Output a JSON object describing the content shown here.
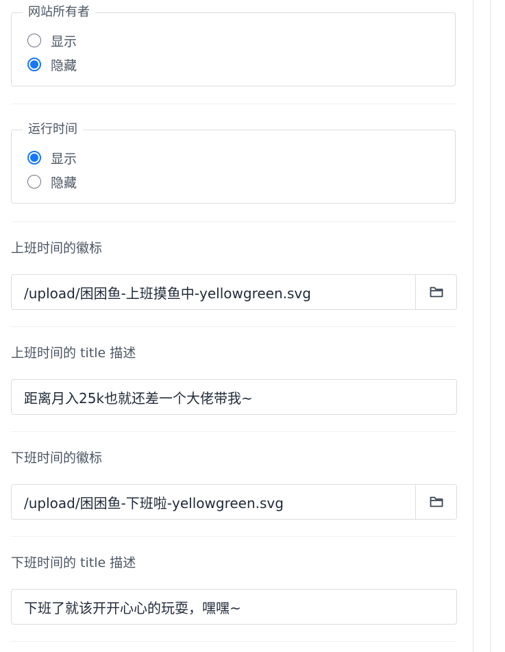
{
  "site_owner": {
    "legend": "网站所有者",
    "options": [
      {
        "label": "显示",
        "checked": false
      },
      {
        "label": "隐藏",
        "checked": true
      }
    ]
  },
  "uptime": {
    "legend": "运行时间",
    "options": [
      {
        "label": "显示",
        "checked": true
      },
      {
        "label": "隐藏",
        "checked": false
      }
    ]
  },
  "work_badge": {
    "label": "上班时间的徽标",
    "value": "/upload/困困鱼-上班摸鱼中-yellowgreen.svg",
    "addon_icon": "folder-icon"
  },
  "work_title": {
    "label": "上班时间的 title 描述",
    "value": "距离月入25k也就还差一个大佬带我~"
  },
  "offwork_badge": {
    "label": "下班时间的徽标",
    "value": "/upload/困困鱼-下班啦-yellowgreen.svg",
    "addon_icon": "folder-icon"
  },
  "offwork_title": {
    "label": "下班时间的 title 描述",
    "value": "下班了就该开开心心的玩耍，嘿嘿~"
  },
  "colors": {
    "accent": "#1677ff",
    "border": "#d9dce1",
    "text": "#4b5563"
  }
}
